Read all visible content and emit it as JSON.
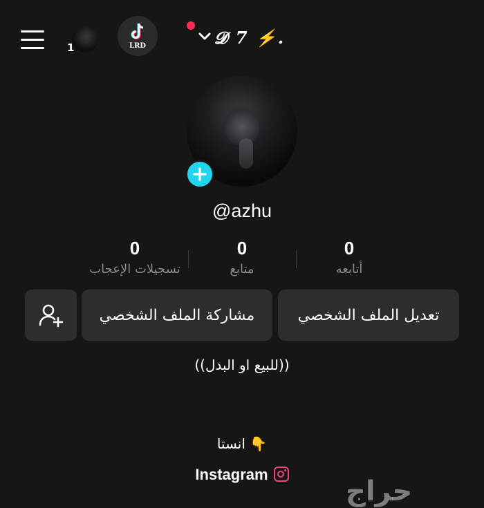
{
  "header": {
    "mini_avatar_count": "1",
    "app_logo_label": "LRD",
    "username_display": "𝓓 7 ⚡.",
    "notification_color": "#fe2c55"
  },
  "profile": {
    "handle": "@azhu",
    "accent_color": "#20d5ec"
  },
  "stats": {
    "likes": {
      "value": "0",
      "label": "تسجيلات الإعجاب"
    },
    "followers": {
      "value": "0",
      "label": "متابع"
    },
    "following": {
      "value": "0",
      "label": "أتابعه"
    }
  },
  "actions": {
    "edit_profile": "تعديل الملف الشخصي",
    "share_profile": "مشاركة الملف الشخصي"
  },
  "bio": {
    "line1": "((للبيع او البدل))",
    "instagram_label": "انستا 👇",
    "instagram_link": "Instagram"
  },
  "watermark": "حراج"
}
